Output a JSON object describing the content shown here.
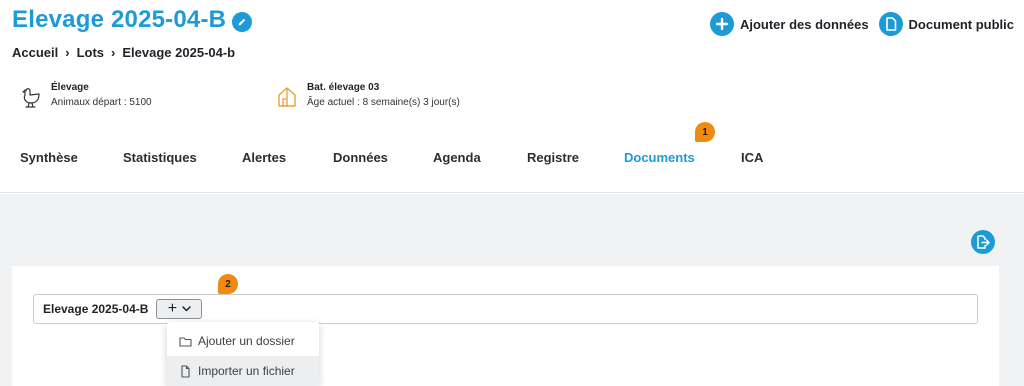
{
  "header": {
    "title": "Elevage 2025-04-B",
    "actions": [
      {
        "label": "Ajouter des données",
        "icon": "plus-circle-icon"
      },
      {
        "label": "Document public",
        "icon": "document-icon"
      }
    ]
  },
  "breadcrumb": [
    "Accueil",
    "Lots",
    "Elevage 2025-04-b"
  ],
  "info": {
    "elevage": {
      "title": "Élevage",
      "detail": "Animaux départ : 5100",
      "icon": "chicken-icon"
    },
    "batiment": {
      "title": "Bat. élevage 03",
      "detail": "Âge actuel : 8 semaine(s) 3 jour(s)",
      "icon": "barn-icon"
    }
  },
  "tabs": [
    "Synthèse",
    "Statistiques",
    "Alertes",
    "Données",
    "Agenda",
    "Registre",
    "Documents",
    "ICA"
  ],
  "active_tab": "Documents",
  "badges": {
    "tab_step": "1",
    "add_step": "2"
  },
  "documents": {
    "path_name": "Elevage 2025-04-B",
    "add_button": "+",
    "menu": [
      "Ajouter un dossier",
      "Importer un fichier"
    ]
  },
  "colors": {
    "accent": "#1d9bd7",
    "badge": "#f08a10",
    "content_bg": "#f1f2f4"
  }
}
